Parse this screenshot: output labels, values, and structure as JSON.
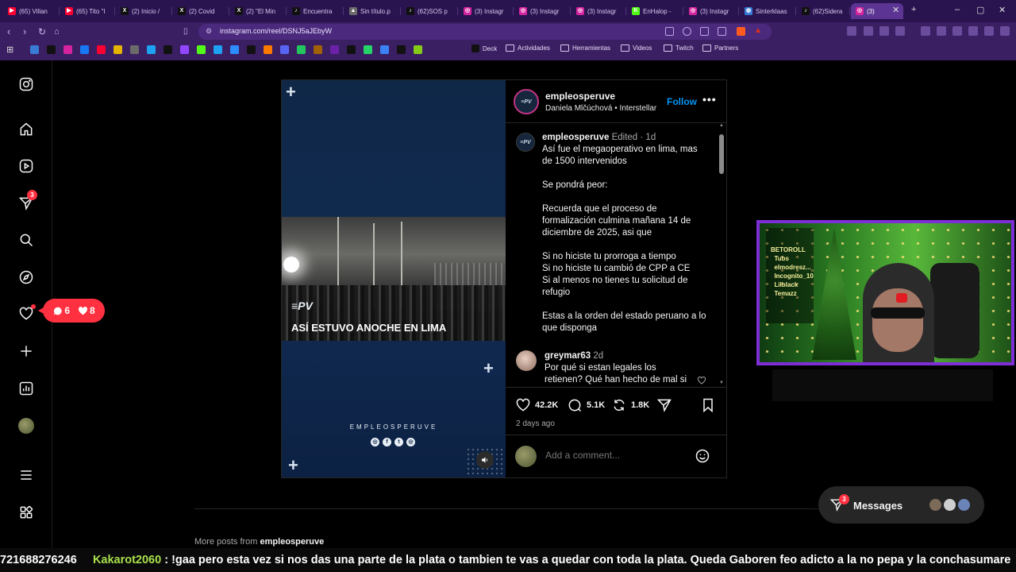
{
  "browser": {
    "tabs": [
      {
        "label": "(65) Villan",
        "icon": "youtube-icon",
        "color": "#ff0033",
        "glyph": "▶"
      },
      {
        "label": "(65) Tito \"I",
        "icon": "youtube-icon",
        "color": "#ff0033",
        "glyph": "▶"
      },
      {
        "label": "(2) Inicio /",
        "icon": "x-icon",
        "color": "#111111",
        "glyph": "X"
      },
      {
        "label": "(2) Covid",
        "icon": "x-icon",
        "color": "#111111",
        "glyph": "X"
      },
      {
        "label": "(2) \"El Min",
        "icon": "x-icon",
        "color": "#111111",
        "glyph": "X"
      },
      {
        "label": "Encuentra",
        "icon": "tiktok-icon",
        "color": "#111111",
        "glyph": "♪"
      },
      {
        "label": "Sin título.p",
        "icon": "drive-icon",
        "color": "#6b6b6b",
        "glyph": "▲"
      },
      {
        "label": "(62)SOS p",
        "icon": "tiktok-icon",
        "color": "#111111",
        "glyph": "♪"
      },
      {
        "label": "(3) Instagr",
        "icon": "instagram-icon",
        "color": "#d6249f",
        "glyph": "◎"
      },
      {
        "label": "(3) Instagr",
        "icon": "instagram-icon",
        "color": "#d6249f",
        "glyph": "◎"
      },
      {
        "label": "(3) Instagr",
        "icon": "instagram-icon",
        "color": "#d6249f",
        "glyph": "◎"
      },
      {
        "label": "EnHalop -",
        "icon": "kick-icon",
        "color": "#53fc18",
        "glyph": "K"
      },
      {
        "label": "(3) Instagr",
        "icon": "instagram-icon",
        "color": "#d6249f",
        "glyph": "◎"
      },
      {
        "label": "Sinterklaas",
        "icon": "globe-icon",
        "color": "#3a7bd5",
        "glyph": "◍"
      },
      {
        "label": "(62)Sidera",
        "icon": "tiktok-icon",
        "color": "#111111",
        "glyph": "♪"
      },
      {
        "label": "(3)",
        "icon": "instagram-icon",
        "color": "#d6249f",
        "glyph": "◎"
      }
    ],
    "url": "instagram.com/reel/DSNJ5aJEbyW",
    "bookmarks": [
      {
        "label": "Deck"
      },
      {
        "label": "Actividades"
      },
      {
        "label": "Herramientas"
      },
      {
        "label": "Videos"
      },
      {
        "label": "Twitch"
      },
      {
        "label": "Partners"
      }
    ],
    "accent": "#3b1f63"
  },
  "nav": {
    "notifications_badge": "3",
    "pill": {
      "comments": "6",
      "likes": "8"
    }
  },
  "reel": {
    "video": {
      "logo": "≡PV",
      "overlay_caption": "ASÍ ESTUVO ANOCHE EN LIMA",
      "brand": "EMPLEOSPERUVE",
      "avatar_logo": "≡PV"
    },
    "header": {
      "username": "empleosperuve",
      "audio": "Daniela Mlčúchová • Interstellar",
      "follow_label": "Follow",
      "more_label": "•••"
    },
    "caption": {
      "username": "empleosperuve",
      "edited": "Edited",
      "age": "1d",
      "lines": [
        "Así fue el megaoperativo en lima, mas de 1500 intervenidos",
        "",
        "Se pondrá peor:",
        "",
        "Recuerda que el proceso de formalización culmina mañana 14 de diciembre de 2025, asi que",
        "",
        "Si no hiciste tu prorroga a tiempo",
        "Si no hiciste tu cambió de CPP a CE",
        "Si al menos no tienes tu solicitud de refugio",
        "",
        "Estas a la orden del estado peruano a lo que disponga"
      ]
    },
    "comment": {
      "username": "greymar63",
      "age": "2d",
      "text": "Por qué si estan legales los retienen? Qué han hecho de mal si"
    },
    "stats": {
      "likes": "42.2K",
      "comments": "5.1K",
      "reposts": "1.8K"
    },
    "posted": "2 days ago",
    "comment_placeholder": "Add a comment..."
  },
  "more_posts": {
    "prefix": "More posts from",
    "username": "empleosperuve"
  },
  "webcam": {
    "overlay_text": "BETOROLL\n  Tubs\n  elmodresz...\n  Incognito_10\n  Lilblack\n  Temazz"
  },
  "messages": {
    "label": "Messages",
    "badge": "3"
  },
  "ticker": {
    "prefix": "721688276246",
    "user": "Kakarot2060",
    "message": ": !gaa pero esta vez si nos das una parte de la plata o tambien te vas a quedar con toda la plata. Queda Gaboren feo adicto a la no pepa y la conchasumare"
  }
}
